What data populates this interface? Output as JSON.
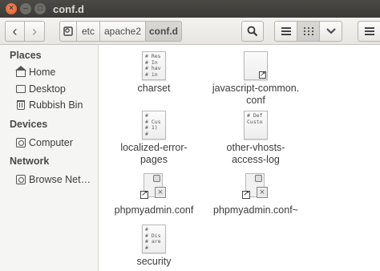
{
  "window": {
    "title": "conf.d",
    "controls": {
      "close": "×",
      "minimize": "–",
      "maximize": "□"
    }
  },
  "toolbar": {
    "back_icon": "‹",
    "forward_icon": "›",
    "breadcrumb": [
      "etc",
      "apache2",
      "conf.d"
    ],
    "search_icon": "search-icon",
    "list_view_icon": "≡",
    "grid_view_icon": "⋮⋮⋮",
    "dropdown_icon": "⌄",
    "menu_icon": "≡"
  },
  "sidebar": {
    "places_heading": "Places",
    "places": [
      {
        "label": "Home",
        "icon": "home-icon"
      },
      {
        "label": "Desktop",
        "icon": "desktop-icon"
      },
      {
        "label": "Rubbish Bin",
        "icon": "trash-icon"
      }
    ],
    "devices_heading": "Devices",
    "devices": [
      {
        "label": "Computer",
        "icon": "computer-icon"
      }
    ],
    "network_heading": "Network",
    "network": [
      {
        "label": "Browse Net…",
        "icon": "network-icon"
      }
    ]
  },
  "files": [
    {
      "name": "charset",
      "preview": "# Res\n# In\n# hav\n# in"
    },
    {
      "name": "javascript-common.\nconf",
      "preview": ""
    },
    {
      "name": "localized-error-\npages",
      "preview": "#\n# Cus\n# 1)\n#"
    },
    {
      "name": "other-vhosts-\naccess-log",
      "preview": "# Def\nCusto"
    },
    {
      "name": "phpmyadmin.conf",
      "preview": "broken-link"
    },
    {
      "name": "phpmyadmin.conf~",
      "preview": "broken-link"
    },
    {
      "name": "security",
      "preview": "#\n# Dis\n# are\n#"
    }
  ]
}
